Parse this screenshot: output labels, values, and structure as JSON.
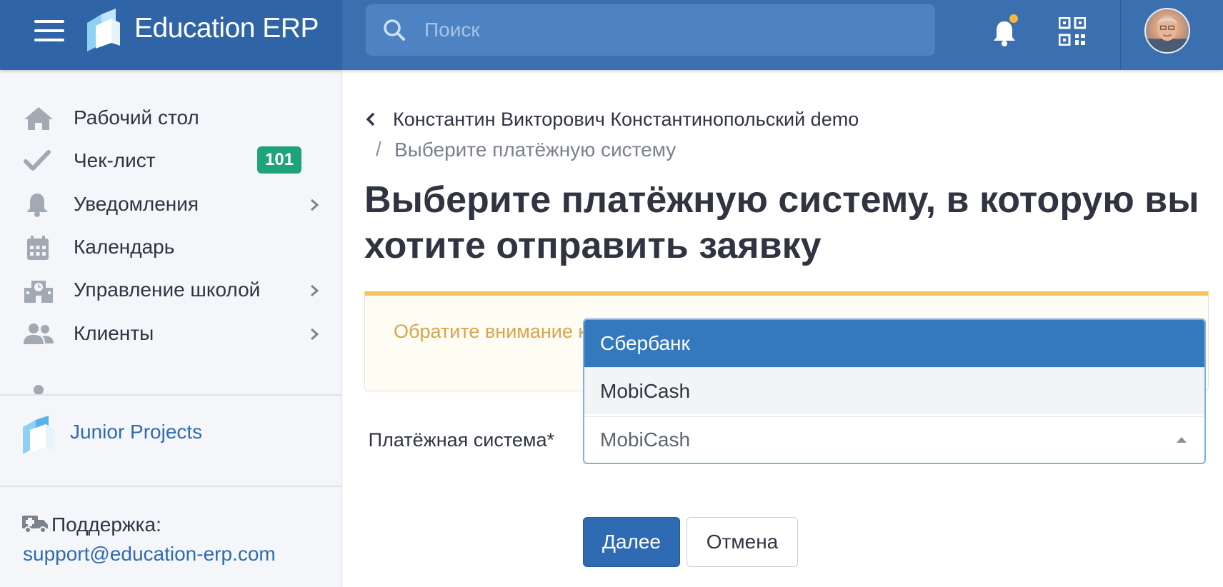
{
  "header": {
    "brand": "Education ERP",
    "search_placeholder": "Поиск",
    "notification_dot_color": "#f5b73c",
    "bell_icon": "bell-icon",
    "qr_icon": "qr-code-icon",
    "accent_color": "#3a6fb0"
  },
  "sidebar": {
    "items": [
      {
        "label": "Рабочий стол",
        "icon": "home-icon"
      },
      {
        "label": "Чек-лист",
        "icon": "check-icon",
        "badge": "101"
      },
      {
        "label": "Уведомления",
        "icon": "bell-icon",
        "has_submenu": true
      },
      {
        "label": "Календарь",
        "icon": "calendar-icon"
      },
      {
        "label": "Управление школой",
        "icon": "school-icon",
        "has_submenu": true
      },
      {
        "label": "Клиенты",
        "icon": "users-icon",
        "has_submenu": true
      }
    ],
    "organization": "Junior Projects",
    "support_label": "Поддержка:",
    "support_email": "support@education-erp.com",
    "badge_color": "#1fa37a"
  },
  "breadcrumb": {
    "parent": "Константин Викторович Константинопольский demo",
    "separator": "/",
    "current": "Выберите платёжную систему"
  },
  "page": {
    "title": "Выберите платёжную систему, в которую вы хотите отправить заявку",
    "notice": "Обратите внимание комиссию от 2% до"
  },
  "form": {
    "label": "Платёжная система*",
    "selected_value": "MobiCash",
    "options": [
      "Сбербанк",
      "MobiCash"
    ],
    "highlighted_option": "Сбербанк",
    "submit_label": "Далее",
    "cancel_label": "Отмена"
  }
}
